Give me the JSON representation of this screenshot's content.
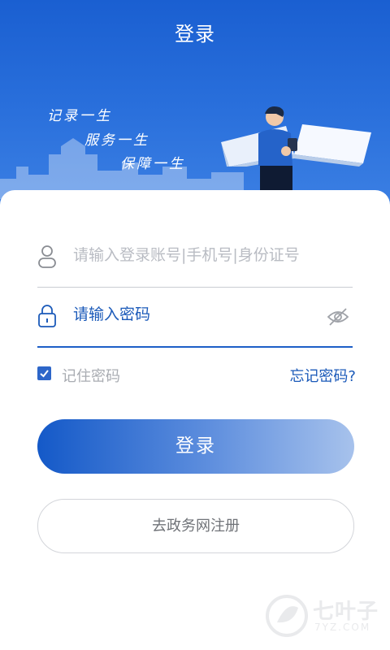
{
  "header": {
    "title": "登录",
    "slogans": [
      "记录一生",
      "服务一生",
      "保障一生"
    ]
  },
  "form": {
    "account_placeholder": "请输入登录账号|手机号|身份证号",
    "password_placeholder": "请输入密码",
    "remember_label": "记住密码",
    "remember_checked": true,
    "forgot_label": "忘记密码?"
  },
  "buttons": {
    "login_label": "登录",
    "register_label": "去政务网注册"
  },
  "watermark": {
    "text": "七叶子",
    "sub": "7YZ.COM"
  },
  "colors": {
    "primary": "#1b5ab9",
    "header_blue": "#2a70dc"
  }
}
